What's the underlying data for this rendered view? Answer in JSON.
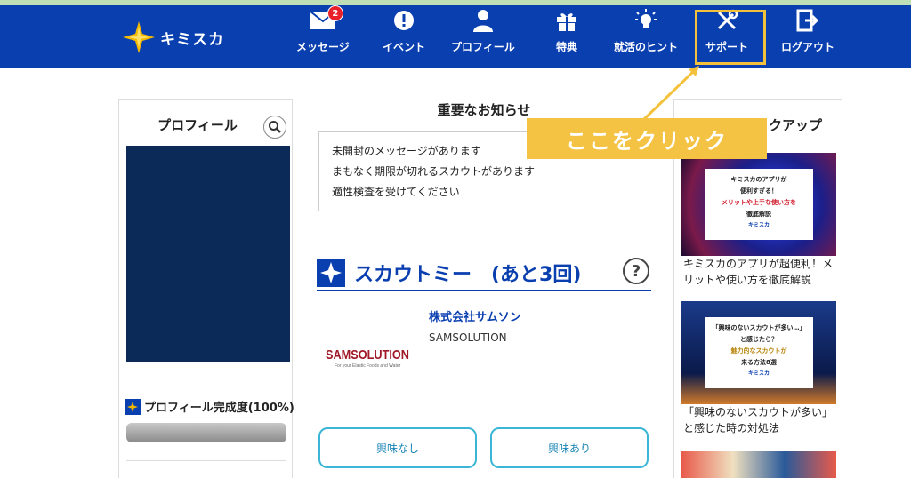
{
  "brand": {
    "name": "キミスカ"
  },
  "nav": {
    "messages": {
      "label": "メッセージ",
      "badge": "2"
    },
    "event": {
      "label": "イベント"
    },
    "profile": {
      "label": "プロフィール"
    },
    "perks": {
      "label": "特典"
    },
    "hints": {
      "label": "就活のヒント"
    },
    "support": {
      "label": "サポート"
    },
    "logout": {
      "label": "ログアウト"
    }
  },
  "profile_card": {
    "title": "プロフィール",
    "completion_label": "プロフィール完成度(100%)",
    "completion_value": 1.0
  },
  "news": {
    "title": "重要なお知らせ",
    "items": [
      "未開封のメッセージがあります",
      "まもなく期限が切れるスカウトがあります",
      "適性検査を受けてください"
    ]
  },
  "scout": {
    "title": "スカウトミー　(あと3回)",
    "help": "?",
    "company": {
      "name": "株式会社サムソン",
      "name_en": "SAMSOLUTION",
      "logo_text": "SAMSOLUTION",
      "logo_tagline": "For your Elastic Foods and Water"
    },
    "buttons": {
      "not_interested": "興味なし",
      "interested": "興味あり"
    }
  },
  "pickup": {
    "title": "ピックアップ",
    "articles": [
      {
        "title": "キミスカのアプリが超便利！メリットや使い方を徹底解説",
        "thumb_lines": [
          "キミスカのアプリが",
          "便利すぎる！",
          "メリットや上手な使い方を",
          "徹底解説"
        ],
        "thumb_brand": "キミスカ"
      },
      {
        "title": "「興味のないスカウトが多い」と感じた時の対処法",
        "thumb_lines": [
          "「興味のないスカウトが多い…」",
          "と感じたら？",
          "魅力的なスカウトが",
          "来る方法8選"
        ],
        "thumb_brand": "キミスカ"
      }
    ]
  },
  "callout": {
    "text": "ここをクリック"
  },
  "colors": {
    "header_bg": "#0a3fb0",
    "highlight": "#f3c13a",
    "callout_bg": "#f5c343",
    "button_border": "#3bb6d6",
    "badge": "#e8202a"
  }
}
